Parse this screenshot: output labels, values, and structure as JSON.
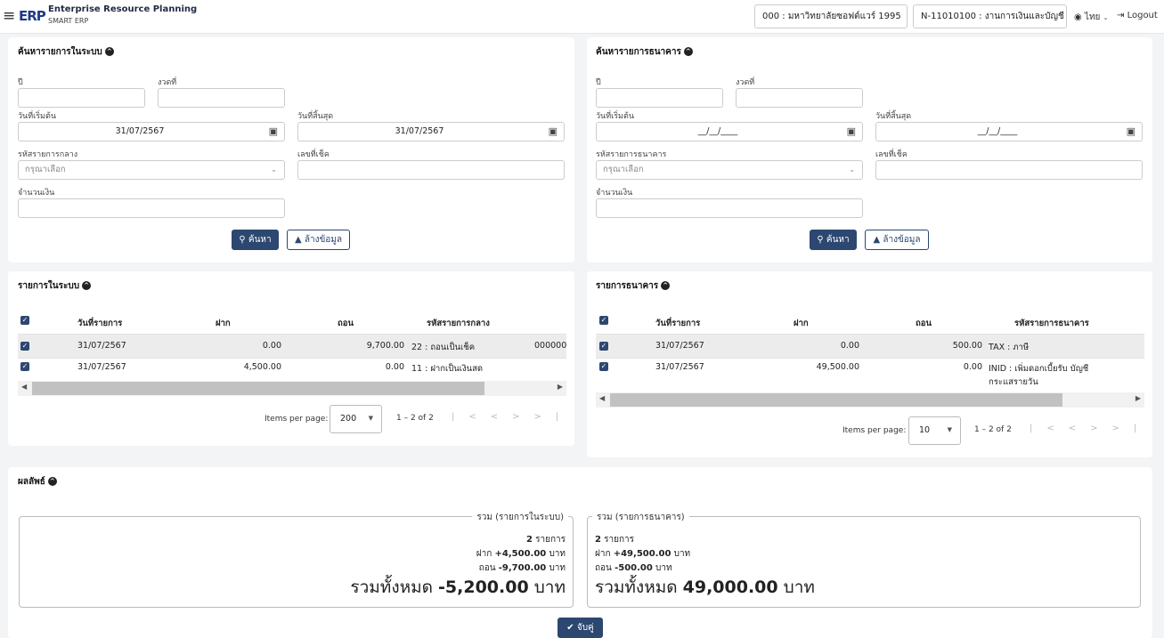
{
  "header": {
    "menu_icon": "hamburger-icon",
    "logo_text": "ERP",
    "app_title": "Enterprise Resource Planning",
    "app_subtitle": "SMART ERP",
    "org_chip": "000 : มหาวิทยาลัยซอฟต์แวร์ 1995",
    "dept_chip": "N-11010100 : งานการเงินและบัญชี",
    "language": "ไทย",
    "logout": "Logout"
  },
  "system_search": {
    "title": "ค้นหารายการในระบบ",
    "year_label": "ปี",
    "year_value": "",
    "period_label": "งวดที่",
    "period_value": "",
    "start_label": "วันที่เริ่มต้น",
    "start_value": "31/07/2567",
    "end_label": "วันที่สิ้นสุด",
    "end_value": "31/07/2567",
    "code_label": "รหัสรายการกลาง",
    "code_placeholder": "กรุณาเลือก",
    "cheque_label": "เลขที่เช็ค",
    "cheque_value": "",
    "amount_label": "จำนวนเงิน",
    "amount_value": "",
    "search_btn": "ค้นหา",
    "clear_btn": "ล้างข้อมูล"
  },
  "bank_search": {
    "title": "ค้นหารายการธนาคาร",
    "year_label": "ปี",
    "year_value": "",
    "period_label": "งวดที่",
    "period_value": "",
    "start_label": "วันที่เริ่มต้น",
    "start_value": "__/__/____",
    "end_label": "วันที่สิ้นสุด",
    "end_value": "__/__/____",
    "code_label": "รหัสรายการธนาคาร",
    "code_placeholder": "กรุณาเลือก",
    "cheque_label": "เลขที่เช็ค",
    "cheque_value": "",
    "amount_label": "จำนวนเงิน",
    "amount_value": "",
    "search_btn": "ค้นหา",
    "clear_btn": "ล้างข้อมูล"
  },
  "system_table": {
    "title": "รายการในระบบ",
    "columns": [
      "วันที่รายการ",
      "ฝาก",
      "ถอน",
      "รหัสรายการกลาง"
    ],
    "rows": [
      {
        "date": "31/07/2567",
        "deposit": "0.00",
        "withdraw": "9,700.00",
        "code": "22 : ถอนเป็นเช็ค",
        "extra": "000000",
        "checked": true
      },
      {
        "date": "31/07/2567",
        "deposit": "4,500.00",
        "withdraw": "0.00",
        "code": "11 : ฝากเป็นเงินสด",
        "extra": "",
        "checked": true
      }
    ],
    "items_per_page_label": "Items per page:",
    "items_per_page": "200",
    "range": "1 – 2 of 2"
  },
  "bank_table": {
    "title": "รายการธนาคาร",
    "columns": [
      "วันที่รายการ",
      "ฝาก",
      "ถอน",
      "รหัสรายการธนาคาร"
    ],
    "rows": [
      {
        "date": "31/07/2567",
        "deposit": "0.00",
        "withdraw": "500.00",
        "code": "TAX : ภาษี",
        "checked": true
      },
      {
        "date": "31/07/2567",
        "deposit": "49,500.00",
        "withdraw": "0.00",
        "code": "INID : เพิ่มดอกเบี้ยรับ บัญชี",
        "code2": "กระแสรายวัน",
        "checked": true
      }
    ],
    "items_per_page_label": "Items per page:",
    "items_per_page": "10",
    "range": "1 – 2 of 2"
  },
  "result": {
    "title": "ผลลัพธ์",
    "system": {
      "legend": "รวม (รายการในระบบ)",
      "count_num": "2",
      "count_unit": "รายการ",
      "deposit_label": "ฝาก",
      "deposit_value": "+4,500.00",
      "withdraw_label": "ถอน",
      "withdraw_value": "-9,700.00",
      "unit": "บาท",
      "total_label": "รวมทั้งหมด",
      "total_value": "-5,200.00"
    },
    "bank": {
      "legend": "รวม (รายการธนาคาร)",
      "count_num": "2",
      "count_unit": "รายการ",
      "deposit_label": "ฝาก",
      "deposit_value": "+49,500.00",
      "withdraw_label": "ถอน",
      "withdraw_value": "-500.00",
      "unit": "บาท",
      "total_label": "รวมทั้งหมด",
      "total_value": "49,000.00"
    },
    "match_btn": "จับคู่"
  }
}
